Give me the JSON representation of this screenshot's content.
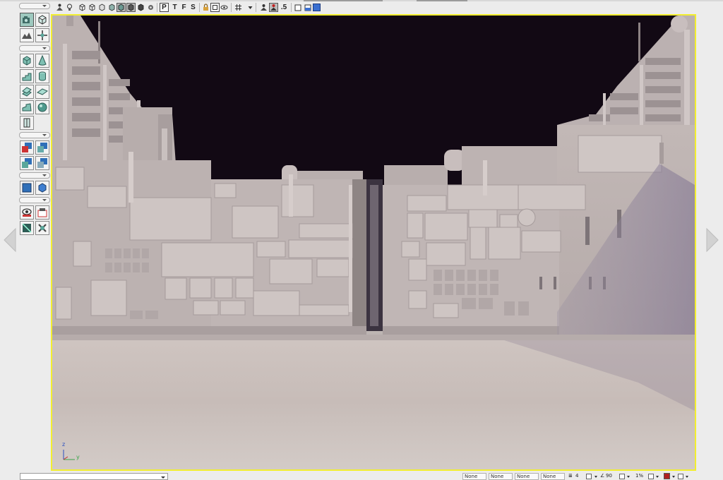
{
  "toolbar": {
    "view_buttons": [
      "P",
      "T",
      "F",
      "S"
    ],
    "snap_label": ".5"
  },
  "palette": {
    "tools": [
      {
        "icon": "camera-icon",
        "selected": true
      },
      {
        "icon": "cube-wire-icon"
      },
      {
        "icon": "terrain-icon"
      },
      {
        "icon": "transform-icon"
      },
      {
        "icon": "cube-brush-icon"
      },
      {
        "icon": "cone-brush-icon"
      },
      {
        "icon": "stairs-brush-icon"
      },
      {
        "icon": "cylinder-brush-icon"
      },
      {
        "icon": "spiral-brush-icon"
      },
      {
        "icon": "sheet-brush-icon"
      },
      {
        "icon": "curved-stairs-icon"
      },
      {
        "icon": "sphere-brush-icon"
      },
      {
        "icon": "volume-icon"
      },
      {
        "icon": "csg-add-icon"
      },
      {
        "icon": "csg-subtract-icon"
      },
      {
        "icon": "csg-intersect-icon"
      },
      {
        "icon": "csg-deintersect-icon"
      },
      {
        "icon": "add-mover-icon"
      },
      {
        "icon": "add-special-icon"
      },
      {
        "icon": "show-selected-icon"
      },
      {
        "icon": "hide-selected-icon"
      },
      {
        "icon": "select-inverse-icon"
      },
      {
        "icon": "hide-invert-icon"
      }
    ]
  },
  "viewport": {
    "axis": {
      "z": "z",
      "y": "y"
    },
    "colors": {
      "sky": "#120914",
      "border": "#f2ee2f",
      "ground": "#c8beba"
    }
  },
  "statusbar": {
    "snap_fields": [
      "None",
      "None",
      "None",
      "None"
    ],
    "grid_value": "4",
    "rotation_value": "90",
    "scale_value": "1%"
  }
}
